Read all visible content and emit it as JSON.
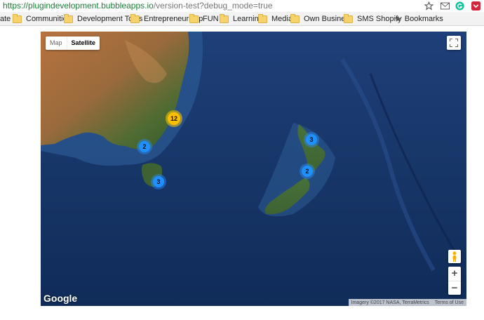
{
  "browser": {
    "url_main": "https://plugindevelopment.bubbleapps.io",
    "url_path": "/version-test?debug_mode=true",
    "icons": [
      "star-icon",
      "mail-icon",
      "grammarly-icon",
      "pocket-icon"
    ]
  },
  "bookmarks": {
    "partial_first": "ate",
    "items": [
      "Communities",
      "Development Tools",
      "Entrepreneurship",
      "FUN",
      "Learning",
      "Media",
      "Own Business",
      "SMS Shopify"
    ],
    "bookmarks_label": "Bookmarks"
  },
  "map": {
    "type_control": {
      "map_label": "Map",
      "satellite_label": "Satellite",
      "selected": "Satellite"
    },
    "clusters": [
      {
        "count": "12",
        "color": "#ffbf00"
      },
      {
        "count": "2",
        "color": "#1e90ff"
      },
      {
        "count": "3",
        "color": "#1e90ff"
      },
      {
        "count": "3",
        "color": "#1e90ff"
      },
      {
        "count": "2",
        "color": "#1e90ff"
      }
    ],
    "zoom_in": "+",
    "zoom_out": "−",
    "logo": "Google",
    "attribution": "Imagery ©2017 NASA, TerraMetrics",
    "terms": "Terms of Use"
  }
}
